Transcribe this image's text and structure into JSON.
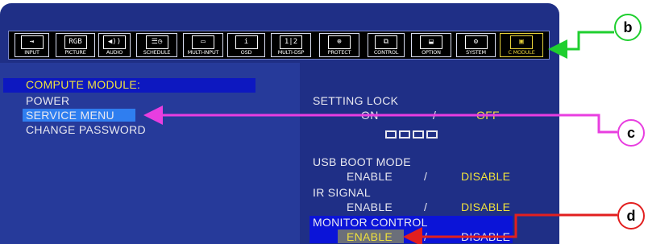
{
  "toolbar": {
    "buttons": [
      {
        "label": "INPUT",
        "icon": "input-icon",
        "glyph": "⇥"
      },
      {
        "label": "PICTURE",
        "icon": "rgb-picture-icon",
        "glyph": "RGB"
      },
      {
        "label": "AUDIO",
        "icon": "speaker-icon",
        "glyph": "◀))"
      },
      {
        "label": "SCHEDULE",
        "icon": "schedule-icon",
        "glyph": "☰◷"
      },
      {
        "label": "MULTI-INPUT",
        "icon": "multi-input-icon",
        "glyph": "▭"
      },
      {
        "label": "OSD",
        "icon": "info-icon",
        "glyph": "i"
      },
      {
        "label": "MULTI-DSP",
        "icon": "multi-display-icon",
        "glyph": "1|2"
      },
      {
        "label": "PROTECT",
        "icon": "protect-icon",
        "glyph": "⊕"
      },
      {
        "label": "CONTROL",
        "icon": "control-icon",
        "glyph": "⧉"
      },
      {
        "label": "OPTION",
        "icon": "option-icon",
        "glyph": "⬓"
      },
      {
        "label": "SYSTEM",
        "icon": "system-gear-icon",
        "glyph": "⚙"
      },
      {
        "label": "C MODULE",
        "icon": "compute-module-icon",
        "glyph": "▣"
      }
    ]
  },
  "left_menu": {
    "title": "COMPUTE MODULE:",
    "items": [
      "POWER",
      "SERVICE MENU",
      "CHANGE PASSWORD"
    ]
  },
  "right_panel": {
    "setting_lock": {
      "label": "SETTING LOCK",
      "on": "ON",
      "sep": "/",
      "off": "OFF"
    },
    "usb_boot": {
      "label": "USB BOOT MODE",
      "enable": "ENABLE",
      "sep": "/",
      "disable": "DISABLE"
    },
    "ir_signal": {
      "label": "IR SIGNAL",
      "enable": "ENABLE",
      "sep": "/",
      "disable": "DISABLE"
    },
    "monitor_control": {
      "label": "MONITOR CONTROL",
      "enable": "ENABLE",
      "sep": "/",
      "disable": "DISABLE"
    }
  },
  "callouts": {
    "b": "b",
    "c": "c",
    "d": "d"
  },
  "colors": {
    "green": "#1fcf2f",
    "magenta": "#e83ee0",
    "red": "#e21f1f",
    "highlight_yellow": "#f0e23c"
  }
}
